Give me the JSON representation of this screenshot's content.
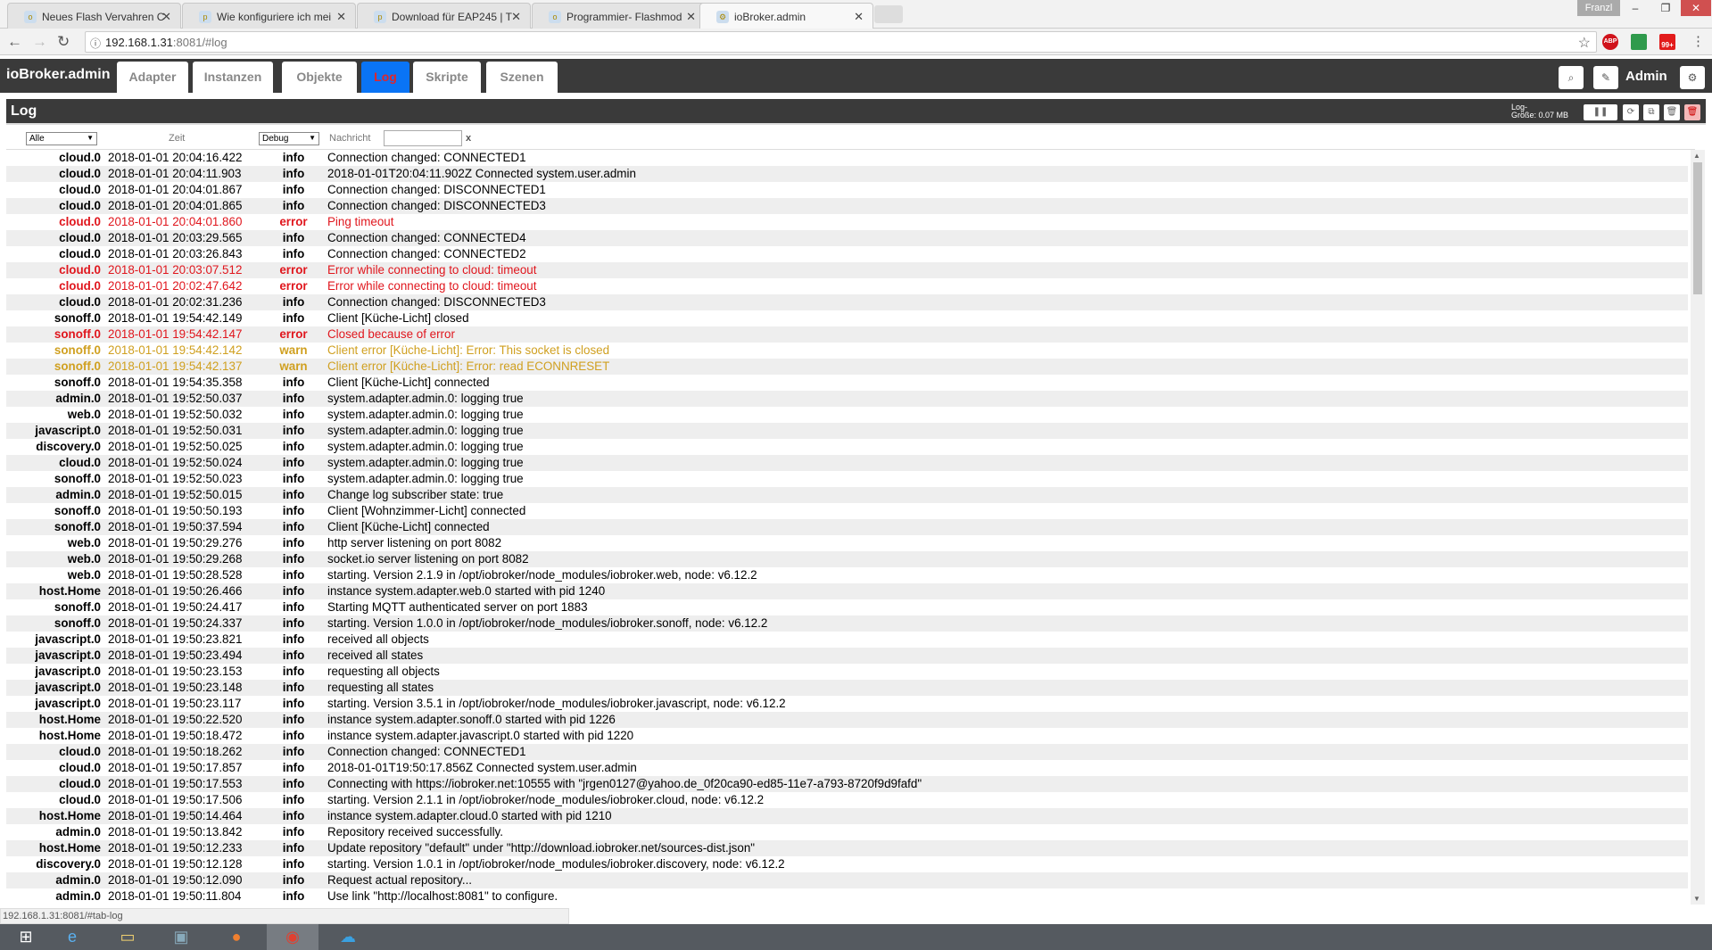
{
  "browser": {
    "tabs": [
      {
        "title": "Neues Flash Vervahren C",
        "icon": "flash-favicon"
      },
      {
        "title": "Wie konfiguriere ich mei",
        "icon": "tplink-favicon"
      },
      {
        "title": "Download für EAP245 | T",
        "icon": "tplink-favicon"
      },
      {
        "title": "Programmier- Flashmod",
        "icon": "flash-favicon"
      },
      {
        "title": "ioBroker.admin",
        "icon": "gear-favicon",
        "active": true
      }
    ],
    "window_user": "Franzl",
    "url_host": "192.168.1.31",
    "url_rest": ":8081/#log",
    "ext_abp": "ABP",
    "ext_badge": "99+",
    "status_url": "192.168.1.31:8081/#tab-log"
  },
  "app": {
    "brand": "ioBroker.admin",
    "tabs": [
      "Adapter",
      "Instanzen",
      "Objekte",
      "Log",
      "Skripte",
      "Szenen"
    ],
    "active_tab": "Log",
    "user": "Admin"
  },
  "log": {
    "title": "Log",
    "size_label": "Log-",
    "size_value": "Größe: 0.07 MB",
    "filters": {
      "source": "Alle",
      "time": "Zeit",
      "level": "Debug",
      "message_label": "Nachricht",
      "message_value": "",
      "clear": "x"
    },
    "colors": {
      "error": "#e0161d",
      "warn": "#d0a020",
      "active_tab": "#0a74f5"
    },
    "rows": [
      [
        "cloud.0",
        "2018-01-01 20:04:16.422",
        "info",
        "Connection changed: CONNECTED1"
      ],
      [
        "cloud.0",
        "2018-01-01 20:04:11.903",
        "info",
        "2018-01-01T20:04:11.902Z Connected system.user.admin"
      ],
      [
        "cloud.0",
        "2018-01-01 20:04:01.867",
        "info",
        "Connection changed: DISCONNECTED1"
      ],
      [
        "cloud.0",
        "2018-01-01 20:04:01.865",
        "info",
        "Connection changed: DISCONNECTED3"
      ],
      [
        "cloud.0",
        "2018-01-01 20:04:01.860",
        "error",
        "Ping timeout"
      ],
      [
        "cloud.0",
        "2018-01-01 20:03:29.565",
        "info",
        "Connection changed: CONNECTED4"
      ],
      [
        "cloud.0",
        "2018-01-01 20:03:26.843",
        "info",
        "Connection changed: CONNECTED2"
      ],
      [
        "cloud.0",
        "2018-01-01 20:03:07.512",
        "error",
        "Error while connecting to cloud: timeout"
      ],
      [
        "cloud.0",
        "2018-01-01 20:02:47.642",
        "error",
        "Error while connecting to cloud: timeout"
      ],
      [
        "cloud.0",
        "2018-01-01 20:02:31.236",
        "info",
        "Connection changed: DISCONNECTED3"
      ],
      [
        "sonoff.0",
        "2018-01-01 19:54:42.149",
        "info",
        "Client [Küche-Licht] closed"
      ],
      [
        "sonoff.0",
        "2018-01-01 19:54:42.147",
        "error",
        "Closed because of error"
      ],
      [
        "sonoff.0",
        "2018-01-01 19:54:42.142",
        "warn",
        "Client error [Küche-Licht]: Error: This socket is closed"
      ],
      [
        "sonoff.0",
        "2018-01-01 19:54:42.137",
        "warn",
        "Client error [Küche-Licht]: Error: read ECONNRESET"
      ],
      [
        "sonoff.0",
        "2018-01-01 19:54:35.358",
        "info",
        "Client [Küche-Licht] connected"
      ],
      [
        "admin.0",
        "2018-01-01 19:52:50.037",
        "info",
        "system.adapter.admin.0: logging true"
      ],
      [
        "web.0",
        "2018-01-01 19:52:50.032",
        "info",
        "system.adapter.admin.0: logging true"
      ],
      [
        "javascript.0",
        "2018-01-01 19:52:50.031",
        "info",
        "system.adapter.admin.0: logging true"
      ],
      [
        "discovery.0",
        "2018-01-01 19:52:50.025",
        "info",
        "system.adapter.admin.0: logging true"
      ],
      [
        "cloud.0",
        "2018-01-01 19:52:50.024",
        "info",
        "system.adapter.admin.0: logging true"
      ],
      [
        "sonoff.0",
        "2018-01-01 19:52:50.023",
        "info",
        "system.adapter.admin.0: logging true"
      ],
      [
        "admin.0",
        "2018-01-01 19:52:50.015",
        "info",
        "Change log subscriber state: true"
      ],
      [
        "sonoff.0",
        "2018-01-01 19:50:50.193",
        "info",
        "Client [Wohnzimmer-Licht] connected"
      ],
      [
        "sonoff.0",
        "2018-01-01 19:50:37.594",
        "info",
        "Client [Küche-Licht] connected"
      ],
      [
        "web.0",
        "2018-01-01 19:50:29.276",
        "info",
        "http server listening on port 8082"
      ],
      [
        "web.0",
        "2018-01-01 19:50:29.268",
        "info",
        "socket.io server listening on port 8082"
      ],
      [
        "web.0",
        "2018-01-01 19:50:28.528",
        "info",
        "starting. Version 2.1.9 in /opt/iobroker/node_modules/iobroker.web, node: v6.12.2"
      ],
      [
        "host.Home",
        "2018-01-01 19:50:26.466",
        "info",
        "instance system.adapter.web.0 started with pid 1240"
      ],
      [
        "sonoff.0",
        "2018-01-01 19:50:24.417",
        "info",
        "Starting MQTT authenticated server on port 1883"
      ],
      [
        "sonoff.0",
        "2018-01-01 19:50:24.337",
        "info",
        "starting. Version 1.0.0 in /opt/iobroker/node_modules/iobroker.sonoff, node: v6.12.2"
      ],
      [
        "javascript.0",
        "2018-01-01 19:50:23.821",
        "info",
        "received all objects"
      ],
      [
        "javascript.0",
        "2018-01-01 19:50:23.494",
        "info",
        "received all states"
      ],
      [
        "javascript.0",
        "2018-01-01 19:50:23.153",
        "info",
        "requesting all objects"
      ],
      [
        "javascript.0",
        "2018-01-01 19:50:23.148",
        "info",
        "requesting all states"
      ],
      [
        "javascript.0",
        "2018-01-01 19:50:23.117",
        "info",
        "starting. Version 3.5.1 in /opt/iobroker/node_modules/iobroker.javascript, node: v6.12.2"
      ],
      [
        "host.Home",
        "2018-01-01 19:50:22.520",
        "info",
        "instance system.adapter.sonoff.0 started with pid 1226"
      ],
      [
        "host.Home",
        "2018-01-01 19:50:18.472",
        "info",
        "instance system.adapter.javascript.0 started with pid 1220"
      ],
      [
        "cloud.0",
        "2018-01-01 19:50:18.262",
        "info",
        "Connection changed: CONNECTED1"
      ],
      [
        "cloud.0",
        "2018-01-01 19:50:17.857",
        "info",
        "2018-01-01T19:50:17.856Z Connected system.user.admin"
      ],
      [
        "cloud.0",
        "2018-01-01 19:50:17.553",
        "info",
        "Connecting with https://iobroker.net:10555 with \"jrgen0127@yahoo.de_0f20ca90-ed85-11e7-a793-8720f9d9fafd\""
      ],
      [
        "cloud.0",
        "2018-01-01 19:50:17.506",
        "info",
        "starting. Version 2.1.1 in /opt/iobroker/node_modules/iobroker.cloud, node: v6.12.2"
      ],
      [
        "host.Home",
        "2018-01-01 19:50:14.464",
        "info",
        "instance system.adapter.cloud.0 started with pid 1210"
      ],
      [
        "admin.0",
        "2018-01-01 19:50:13.842",
        "info",
        "Repository received successfully."
      ],
      [
        "host.Home",
        "2018-01-01 19:50:12.233",
        "info",
        "Update repository \"default\" under \"http://download.iobroker.net/sources-dist.json\""
      ],
      [
        "discovery.0",
        "2018-01-01 19:50:12.128",
        "info",
        "starting. Version 1.0.1 in /opt/iobroker/node_modules/iobroker.discovery, node: v6.12.2"
      ],
      [
        "admin.0",
        "2018-01-01 19:50:12.090",
        "info",
        "Request actual repository..."
      ],
      [
        "admin.0",
        "2018-01-01 19:50:11.804",
        "info",
        "Use link \"http://localhost:8081\" to configure."
      ]
    ]
  }
}
